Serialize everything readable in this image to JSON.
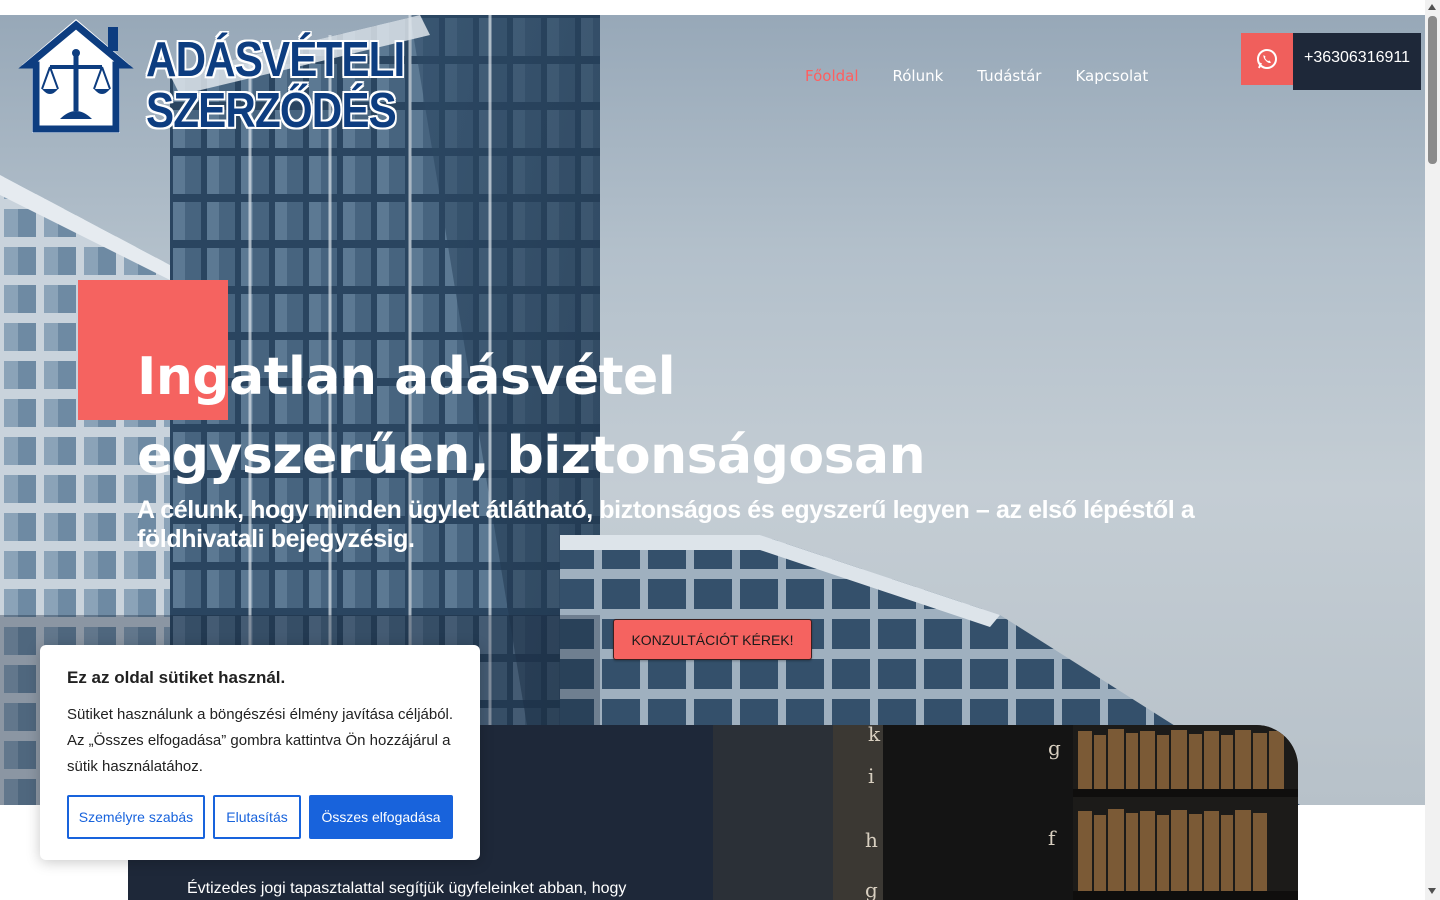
{
  "logo": {
    "line1": "ADÁSVÉTELI",
    "line2": "SZERZŐDÉS",
    "icon": "scales-house-icon",
    "color": "#0d3d80"
  },
  "nav": {
    "items": [
      "Főoldal",
      "Rólunk",
      "Tudástár",
      "Kapcsolat"
    ],
    "active": "Főoldal"
  },
  "contact": {
    "icon": "whatsapp-icon",
    "phone": "+36306316911"
  },
  "hero": {
    "title_line1": "Ingatlan adásvétel",
    "title_line2": "egyszerűen, biztonságosan",
    "subtitle": "A célunk, hogy minden ügylet átlátható, biztonságos és egyszerű legyen – az első lépéstől a földhivatali bejegyzésig.",
    "cta": "KONZULTÁCIÓT KÉREK!"
  },
  "about": {
    "text": "Évtizedes jogi tapasztalattal segítjük ügyfeleinket abban, hogy"
  },
  "cookie": {
    "title": "Ez az oldal sütiket használ.",
    "text": "Sütiket használunk a böngészési élmény javítása céljából. Az „Összes elfogadása” gombra kattintva Ön hozzájárul a sütik használatához.",
    "customize": "Személyre szabás",
    "reject": "Elutasítás",
    "accept": "Összes elfogadása"
  },
  "colors": {
    "accent": "#f56360",
    "dark": "#1e2839",
    "cookie_blue": "#1863dc"
  }
}
